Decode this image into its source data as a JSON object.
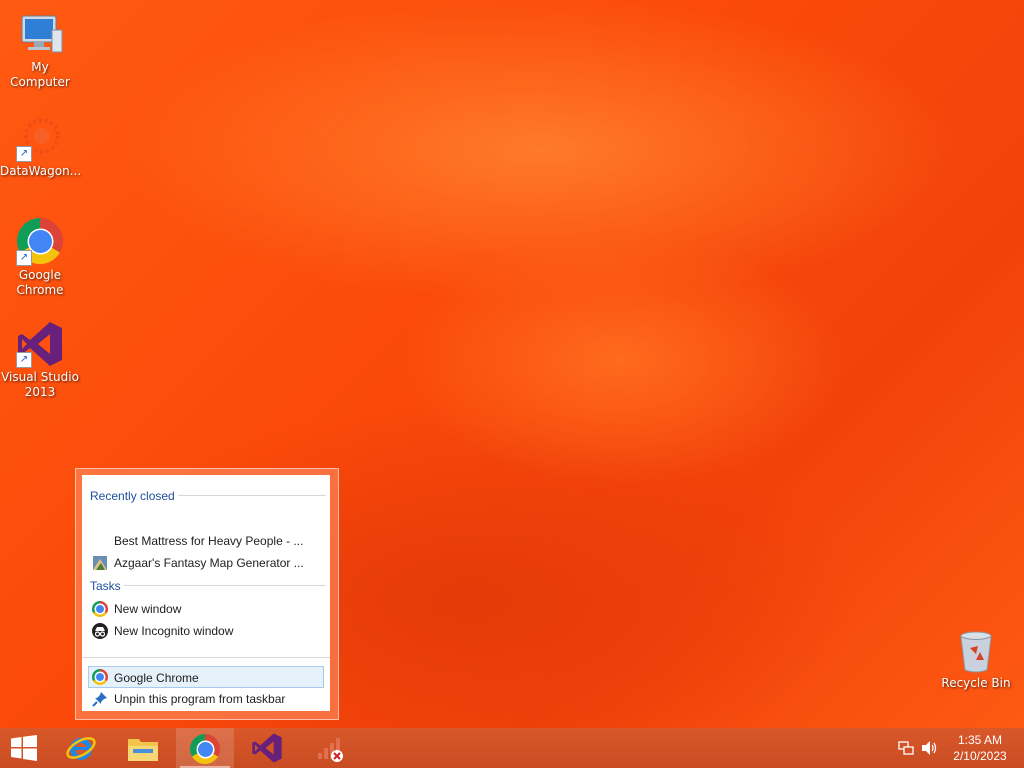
{
  "desktop": {
    "icons": [
      {
        "label": "My Computer",
        "icon": "my-computer-icon"
      },
      {
        "label": "DataWagon...",
        "icon": "datawagon-icon"
      },
      {
        "label": "Google Chrome",
        "icon": "chrome-icon"
      },
      {
        "label": "Visual Studio 2013",
        "icon": "visual-studio-icon"
      },
      {
        "label": "Recycle Bin",
        "icon": "recycle-bin-icon"
      }
    ]
  },
  "jumplist": {
    "recent_header": "Recently closed",
    "recent": [
      {
        "label": "Best Mattress for Heavy People - ...",
        "icon": "none"
      },
      {
        "label": "Azgaar's Fantasy Map Generator ...",
        "icon": "map-icon"
      }
    ],
    "tasks_header": "Tasks",
    "tasks": [
      {
        "label": "New window",
        "icon": "chrome-icon"
      },
      {
        "label": "New Incognito window",
        "icon": "incognito-icon"
      }
    ],
    "pinned": [
      {
        "label": "Google Chrome",
        "icon": "chrome-icon",
        "selected": true
      },
      {
        "label": "Unpin this program from taskbar",
        "icon": "unpin-icon"
      }
    ]
  },
  "taskbar": {
    "apps": [
      "start-icon",
      "internet-explorer-icon",
      "file-explorer-icon",
      "chrome-icon",
      "visual-studio-icon",
      "network-status-icon"
    ],
    "tray": {
      "time": "1:35 AM",
      "date": "2/10/2023"
    }
  },
  "colors": {
    "accent": "#1e4f9c",
    "taskbar": "#d0522a",
    "wallpaper": "#f94a0c"
  }
}
